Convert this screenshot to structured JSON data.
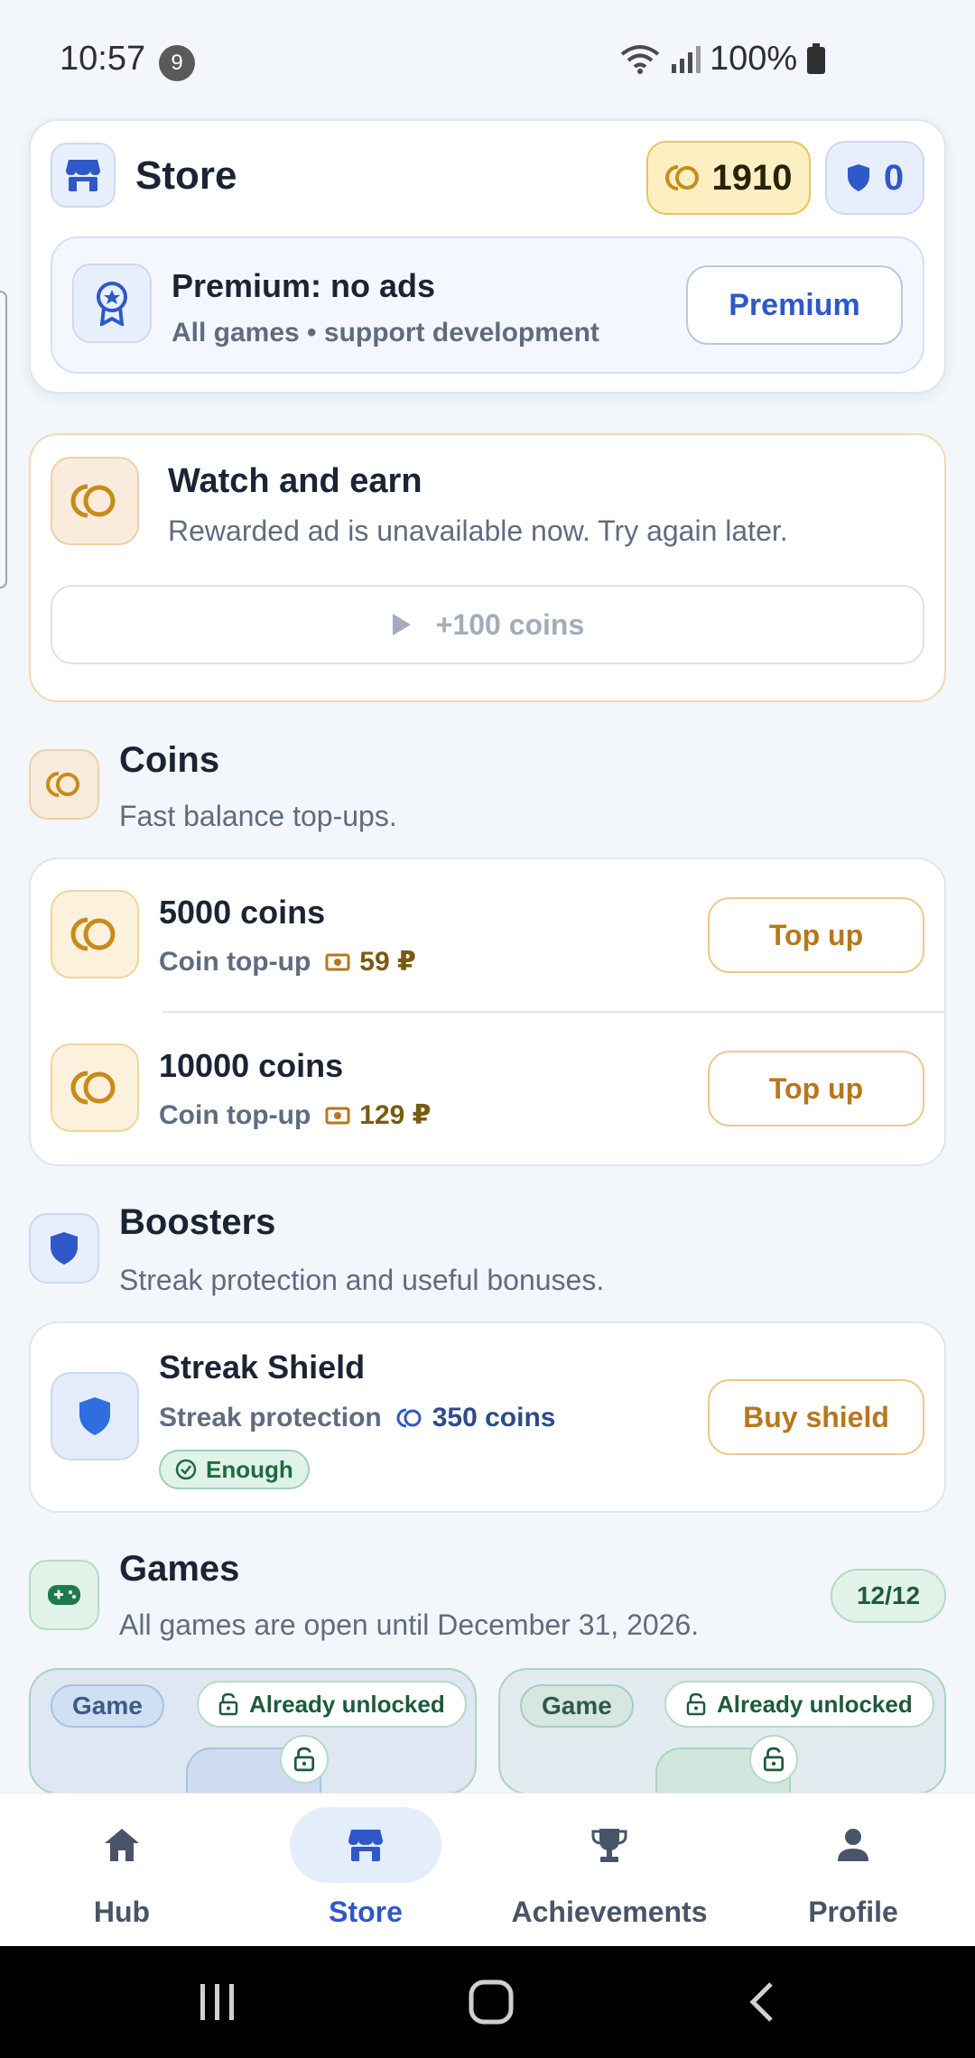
{
  "status_bar": {
    "time": "10:57",
    "notification_count": "9",
    "battery": "100%"
  },
  "store": {
    "title": "Store",
    "coins": "1910",
    "shields": "0"
  },
  "premium": {
    "title": "Premium: no ads",
    "subtitle": "All games • support development",
    "button": "Premium"
  },
  "watch": {
    "title": "Watch and earn",
    "subtitle": "Rewarded ad is unavailable now. Try again later.",
    "button": "+100 coins"
  },
  "coins_section": {
    "title": "Coins",
    "subtitle": "Fast balance top-ups.",
    "items": [
      {
        "title": "5000 coins",
        "subtitle": "Coin top-up",
        "price": "59 ₽",
        "button": "Top up"
      },
      {
        "title": "10000 coins",
        "subtitle": "Coin top-up",
        "price": "129 ₽",
        "button": "Top up"
      }
    ]
  },
  "boosters_section": {
    "title": "Boosters",
    "subtitle": "Streak protection and useful bonuses.",
    "item": {
      "title": "Streak Shield",
      "subtitle": "Streak protection",
      "price": "350 coins",
      "badge": "Enough",
      "button": "Buy shield"
    }
  },
  "games_section": {
    "title": "Games",
    "subtitle": "All games are open until December 31, 2026.",
    "count": "12/12",
    "cards": [
      {
        "tag": "Game",
        "badge": "Already unlocked"
      },
      {
        "tag": "Game",
        "badge": "Already unlocked"
      }
    ]
  },
  "bottom_nav": {
    "items": [
      {
        "label": "Hub"
      },
      {
        "label": "Store"
      },
      {
        "label": "Achievements"
      },
      {
        "label": "Profile"
      }
    ],
    "active": "Store"
  },
  "colors": {
    "accent_blue": "#2f58c8",
    "gold": "#b7771c",
    "green": "#1e5a3c"
  }
}
